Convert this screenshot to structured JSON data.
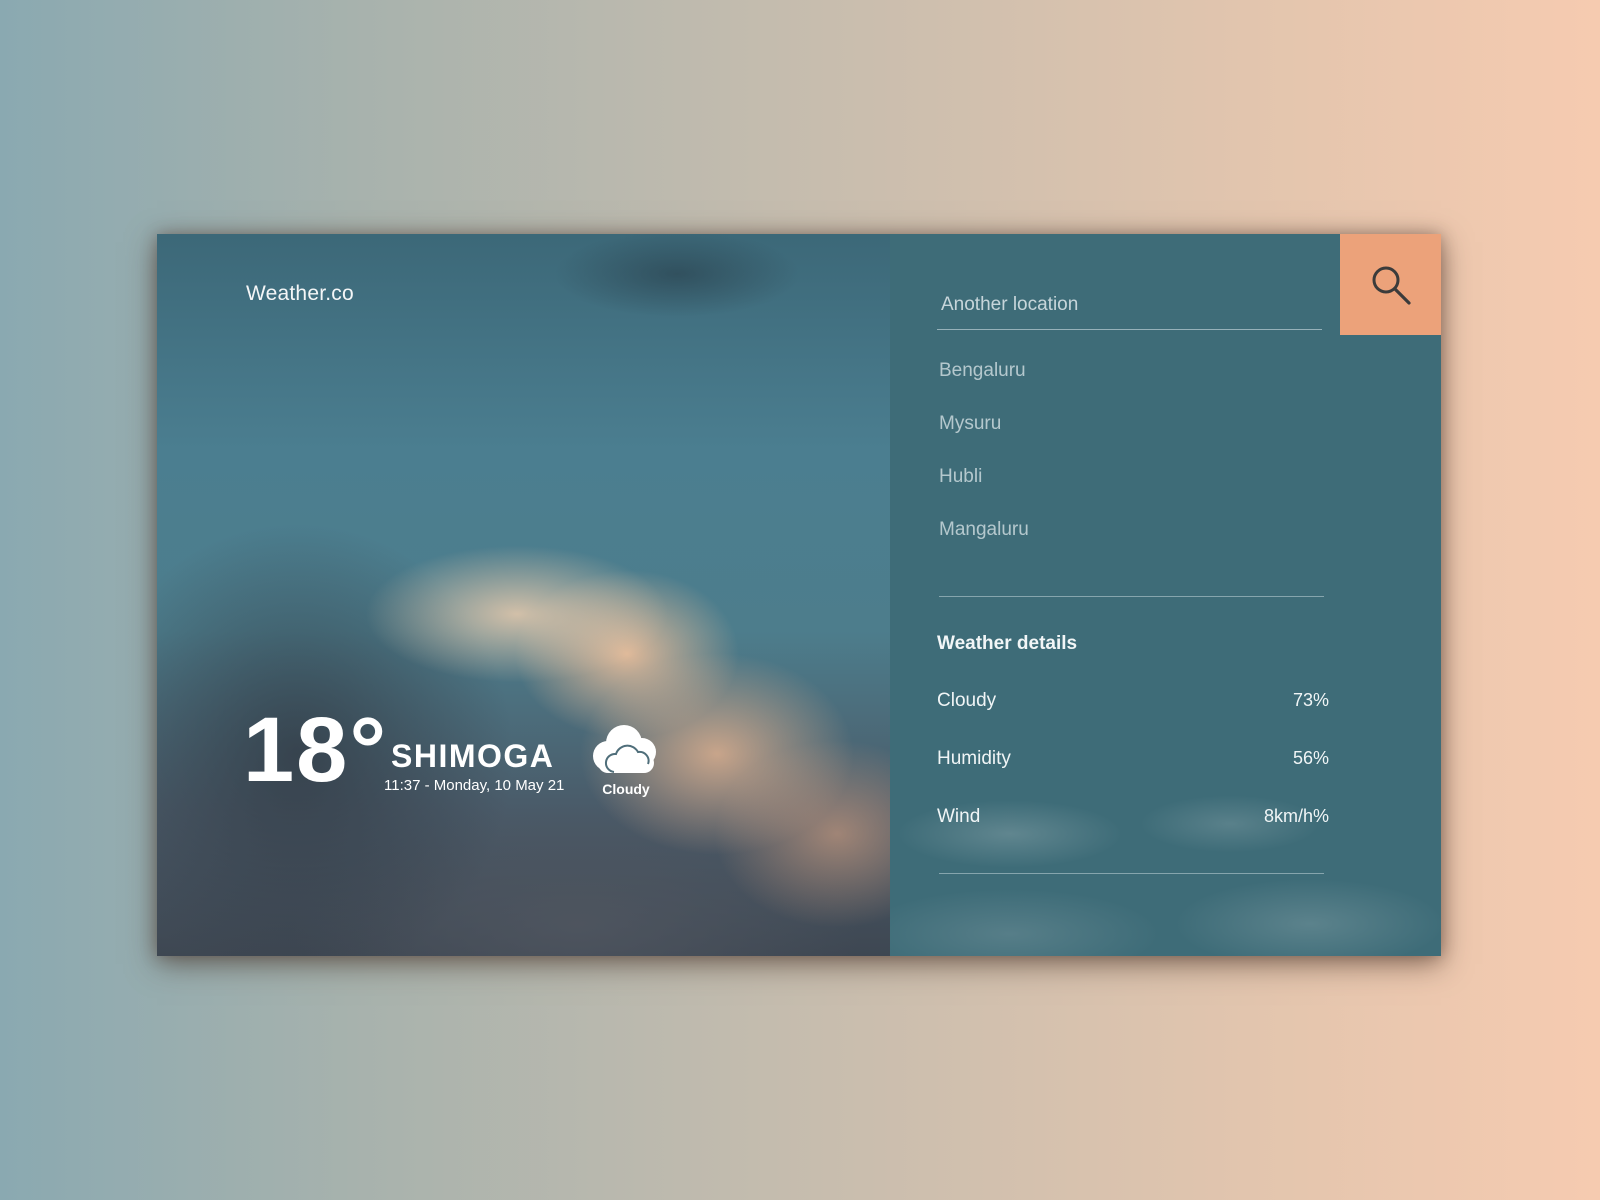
{
  "brand": "Weather.co",
  "current": {
    "temperature": "18°",
    "city": "SHIMOGA",
    "datetime": "11:37 - Monday, 10 May 21",
    "condition": "Cloudy",
    "condition_icon": "cloud-icon"
  },
  "search": {
    "placeholder": "Another location",
    "icon": "search-icon"
  },
  "locations": [
    "Bengaluru",
    "Mysuru",
    "Hubli",
    "Mangaluru"
  ],
  "details": {
    "title": "Weather details",
    "rows": [
      {
        "label": "Cloudy",
        "value": "73%"
      },
      {
        "label": "Humidity",
        "value": "56%"
      },
      {
        "label": "Wind",
        "value": "8km/h%"
      }
    ]
  },
  "colors": {
    "accent": "#eca27a",
    "panel": "#3e6c78"
  }
}
